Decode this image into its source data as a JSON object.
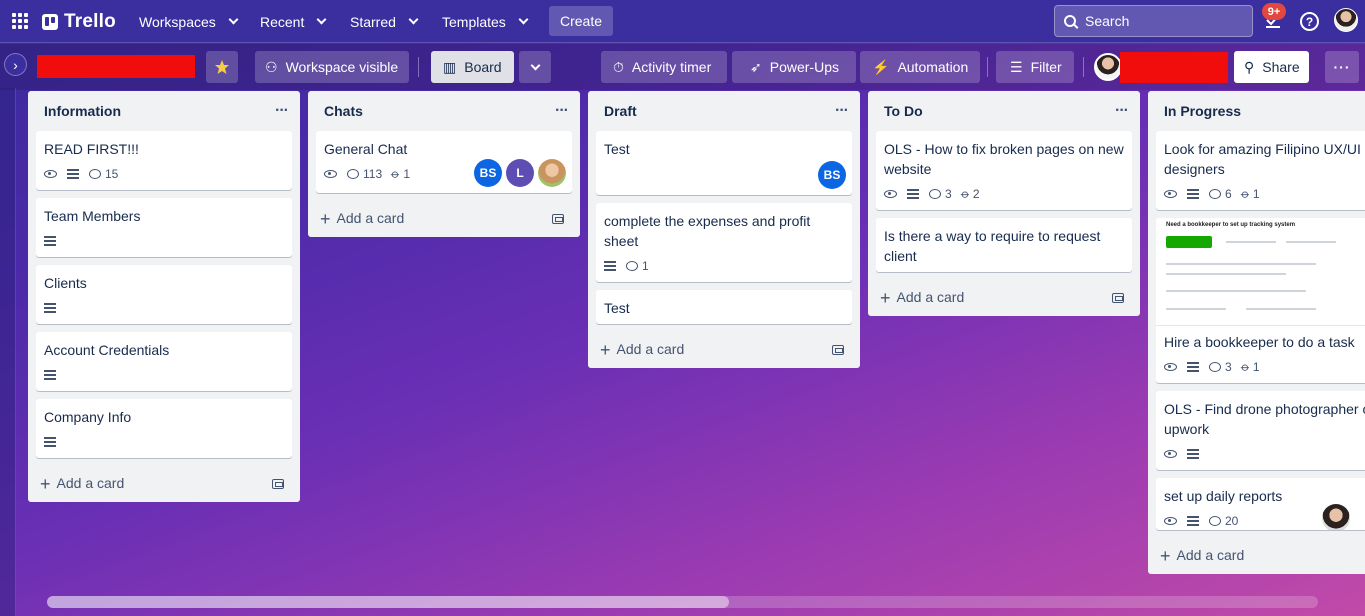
{
  "topnav": {
    "logo": "Trello",
    "menus": [
      "Workspaces",
      "Recent",
      "Starred",
      "Templates"
    ],
    "create": "Create",
    "search_placeholder": "Search",
    "notifications_badge": "9+",
    "help": "?"
  },
  "board_header": {
    "workspace_visible": "Workspace visible",
    "board_view": "Board",
    "activity_timer": "Activity timer",
    "power_ups": "Power-Ups",
    "automation": "Automation",
    "filter": "Filter",
    "share": "Share"
  },
  "lists": [
    {
      "title": "Information",
      "add_card": "Add a card",
      "cards": [
        {
          "title": "READ FIRST!!!",
          "comments": "15"
        },
        {
          "title": "Team Members"
        },
        {
          "title": "Clients"
        },
        {
          "title": "Account Credentials"
        },
        {
          "title": "Company Info"
        }
      ]
    },
    {
      "title": "Chats",
      "add_card": "Add a card",
      "cards": [
        {
          "title": "General Chat",
          "comments": "113",
          "attachments": "1",
          "members": [
            "BS",
            "L"
          ]
        }
      ]
    },
    {
      "title": "Draft",
      "add_card": "Add a card",
      "cards": [
        {
          "title": "Test",
          "members": [
            "BS"
          ]
        },
        {
          "title": "complete the expenses and profit sheet",
          "comments": "1"
        },
        {
          "title": "Test"
        }
      ]
    },
    {
      "title": "To Do",
      "add_card": "Add a card",
      "cards": [
        {
          "title": "OLS - How to fix broken pages on new website",
          "comments": "3",
          "attachments": "2"
        },
        {
          "title": "Is there a way to require to request client"
        }
      ]
    },
    {
      "title": "In Progress",
      "add_card": "Add a card",
      "cards": [
        {
          "title": "Look for amazing Filipino UX/UI designers",
          "comments": "6",
          "attachments": "1"
        },
        {
          "title": "Hire a bookkeeper to do a task",
          "comments": "3",
          "attachments": "1",
          "cover_heading": "Need a bookkeeper to set up tracking system"
        },
        {
          "title": "OLS - Find drone photographer on upwork"
        },
        {
          "title": "set up daily reports",
          "comments": "20"
        }
      ]
    }
  ],
  "colors": {
    "nav_bg": "#3b2e9e",
    "member_bs": "#0c66e4",
    "member_l": "#5e4db2",
    "redaction": "#f20d0d"
  }
}
